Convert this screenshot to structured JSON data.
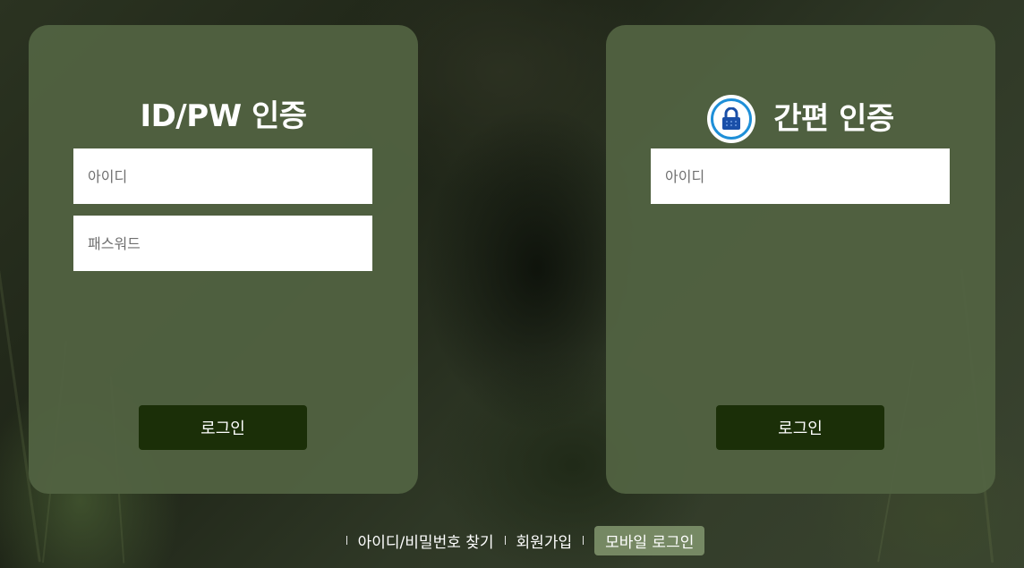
{
  "idpw_card": {
    "title": "ID/PW 인증",
    "id_placeholder": "아이디",
    "pw_placeholder": "패스워드",
    "login_label": "로그인"
  },
  "simple_card": {
    "title": "간편 인증",
    "icon": "lock-icon",
    "id_placeholder": "아이디",
    "login_label": "로그인"
  },
  "footer": {
    "find_account": "아이디/비밀번호 찾기",
    "signup": "회원가입",
    "mobile_login": "모바일 로그인"
  },
  "colors": {
    "card_bg": "#526342",
    "button_bg": "#1b2f08",
    "lock_ring": "#1e8fd8",
    "lock_body": "#1a4fa8"
  }
}
